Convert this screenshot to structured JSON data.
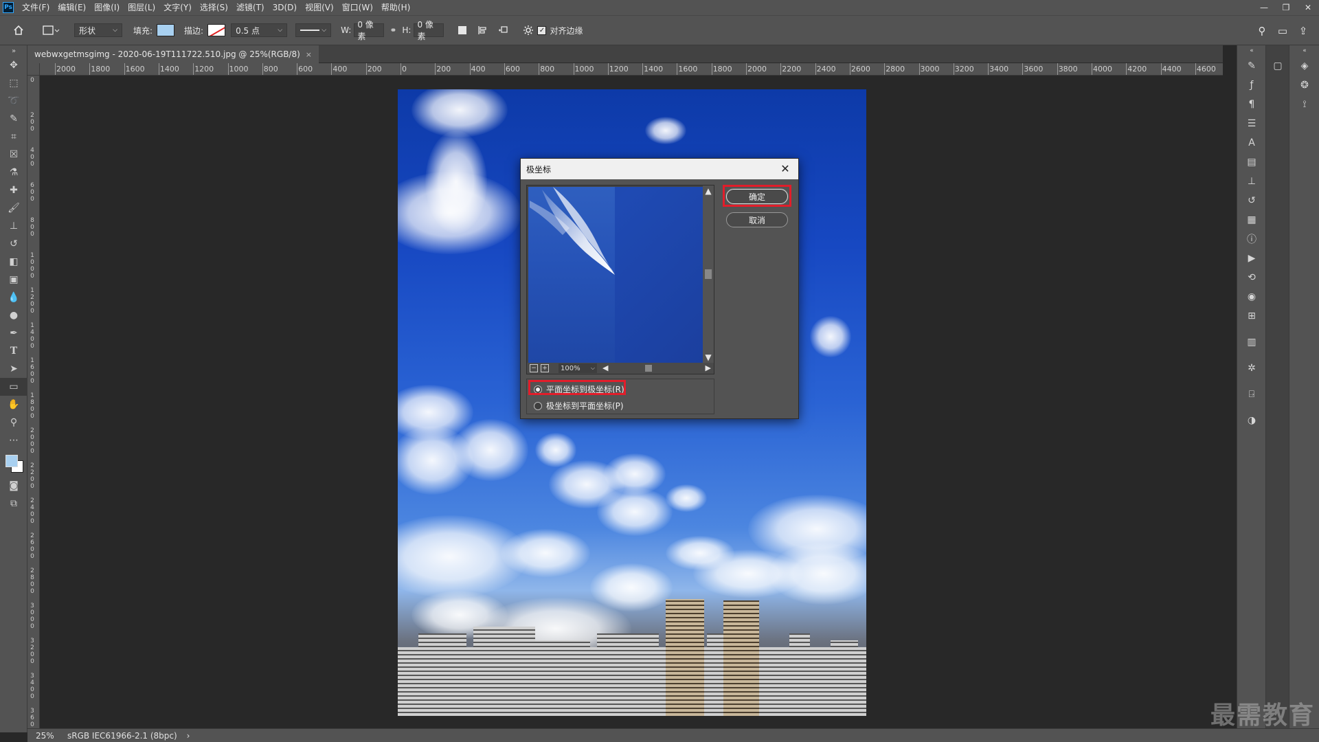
{
  "app": {
    "logo": "Ps"
  },
  "menu": [
    "文件(F)",
    "编辑(E)",
    "图像(I)",
    "图层(L)",
    "文字(Y)",
    "选择(S)",
    "滤镜(T)",
    "3D(D)",
    "视图(V)",
    "窗口(W)",
    "帮助(H)"
  ],
  "window_controls": {
    "minimize": "—",
    "restore": "❐",
    "close": "✕"
  },
  "options": {
    "mode": "形状",
    "fill_label": "填充:",
    "stroke_label": "描边:",
    "stroke_width": "0.5 点",
    "w_label": "W:",
    "w_value": "0 像素",
    "h_label": "H:",
    "h_value": "0 像素",
    "align_edges": "对齐边缘",
    "fill_color": "#a8d0f0"
  },
  "document": {
    "tab_title": "webwxgetmsgimg - 2020-06-19T111722.510.jpg @ 25%(RGB/8)",
    "close": "×"
  },
  "ruler": {
    "h_labels": [
      "2000",
      "1800",
      "1600",
      "1400",
      "1200",
      "1000",
      "800",
      "600",
      "400",
      "200",
      "0",
      "200",
      "400",
      "600",
      "800",
      "1000",
      "1200",
      "1400",
      "1600",
      "1800",
      "2000",
      "2200",
      "2400",
      "2600",
      "2800",
      "3000",
      "3200",
      "3400",
      "3600",
      "3800",
      "4000",
      "4200",
      "4400",
      "4600"
    ],
    "v_labels": [
      "0",
      "200",
      "400",
      "600",
      "800",
      "1000",
      "1200",
      "1400",
      "1600",
      "1800",
      "2000",
      "2200",
      "2400",
      "2600",
      "2800",
      "3000",
      "3200",
      "3400",
      "3600"
    ]
  },
  "dialog": {
    "title": "极坐标",
    "close": "✕",
    "ok": "确定",
    "cancel": "取消",
    "zoom": "100%",
    "option1": "平面坐标到极坐标(R)",
    "option2": "极坐标到平面坐标(P)",
    "selected_option": 1
  },
  "status": {
    "zoom": "25%",
    "profile": "sRGB IEC61966-2.1 (8bpc)",
    "arrow": "›"
  },
  "watermark": "最需教育"
}
